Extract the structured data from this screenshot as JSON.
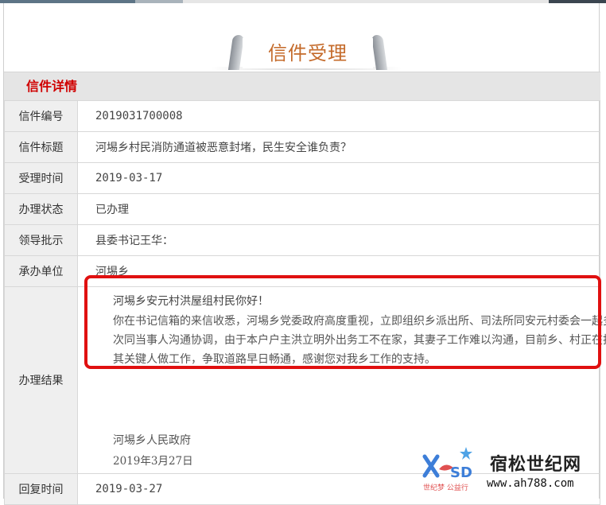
{
  "header": {
    "title": "信件受理"
  },
  "section": {
    "title": "信件详情"
  },
  "rows": [
    {
      "label": "信件编号",
      "value": "2019031700008"
    },
    {
      "label": "信件标题",
      "value": "河埸乡村民消防通道被恶意封堵，民生安全谁负责？"
    },
    {
      "label": "受理时间",
      "value": "2019-03-17"
    },
    {
      "label": "办理状态",
      "value": "已办理"
    },
    {
      "label": "领导批示",
      "value": "县委书记王华："
    },
    {
      "label": "承办单位",
      "value": "河埸乡"
    }
  ],
  "result": {
    "label": "办理结果",
    "greeting": "河埸乡安元村洪屋组村民你好！",
    "body": "你在书记信箱的来信收悉，河埸乡党委政府高度重视，立即组织乡派出所、司法所同安元村委会一起多次同当事人沟通协调，由于本户户主洪立明外出务工不在家，其妻子工作难以沟通，目前乡、村正在找其关键人做工作，争取道路早日畅通，感谢您对我乡工作的支持。",
    "org": "河埸乡人民政府",
    "date": "2019年3月27日"
  },
  "reply": {
    "label": "回复时间",
    "value": "2019-03-27"
  },
  "watermark": {
    "site": "宿松世纪网",
    "url": "www.ah788.com",
    "tag": "世纪梦 公益行"
  },
  "colors": {
    "title": "#c46a2a",
    "section": "#d00000",
    "highlight": "#e01010"
  }
}
